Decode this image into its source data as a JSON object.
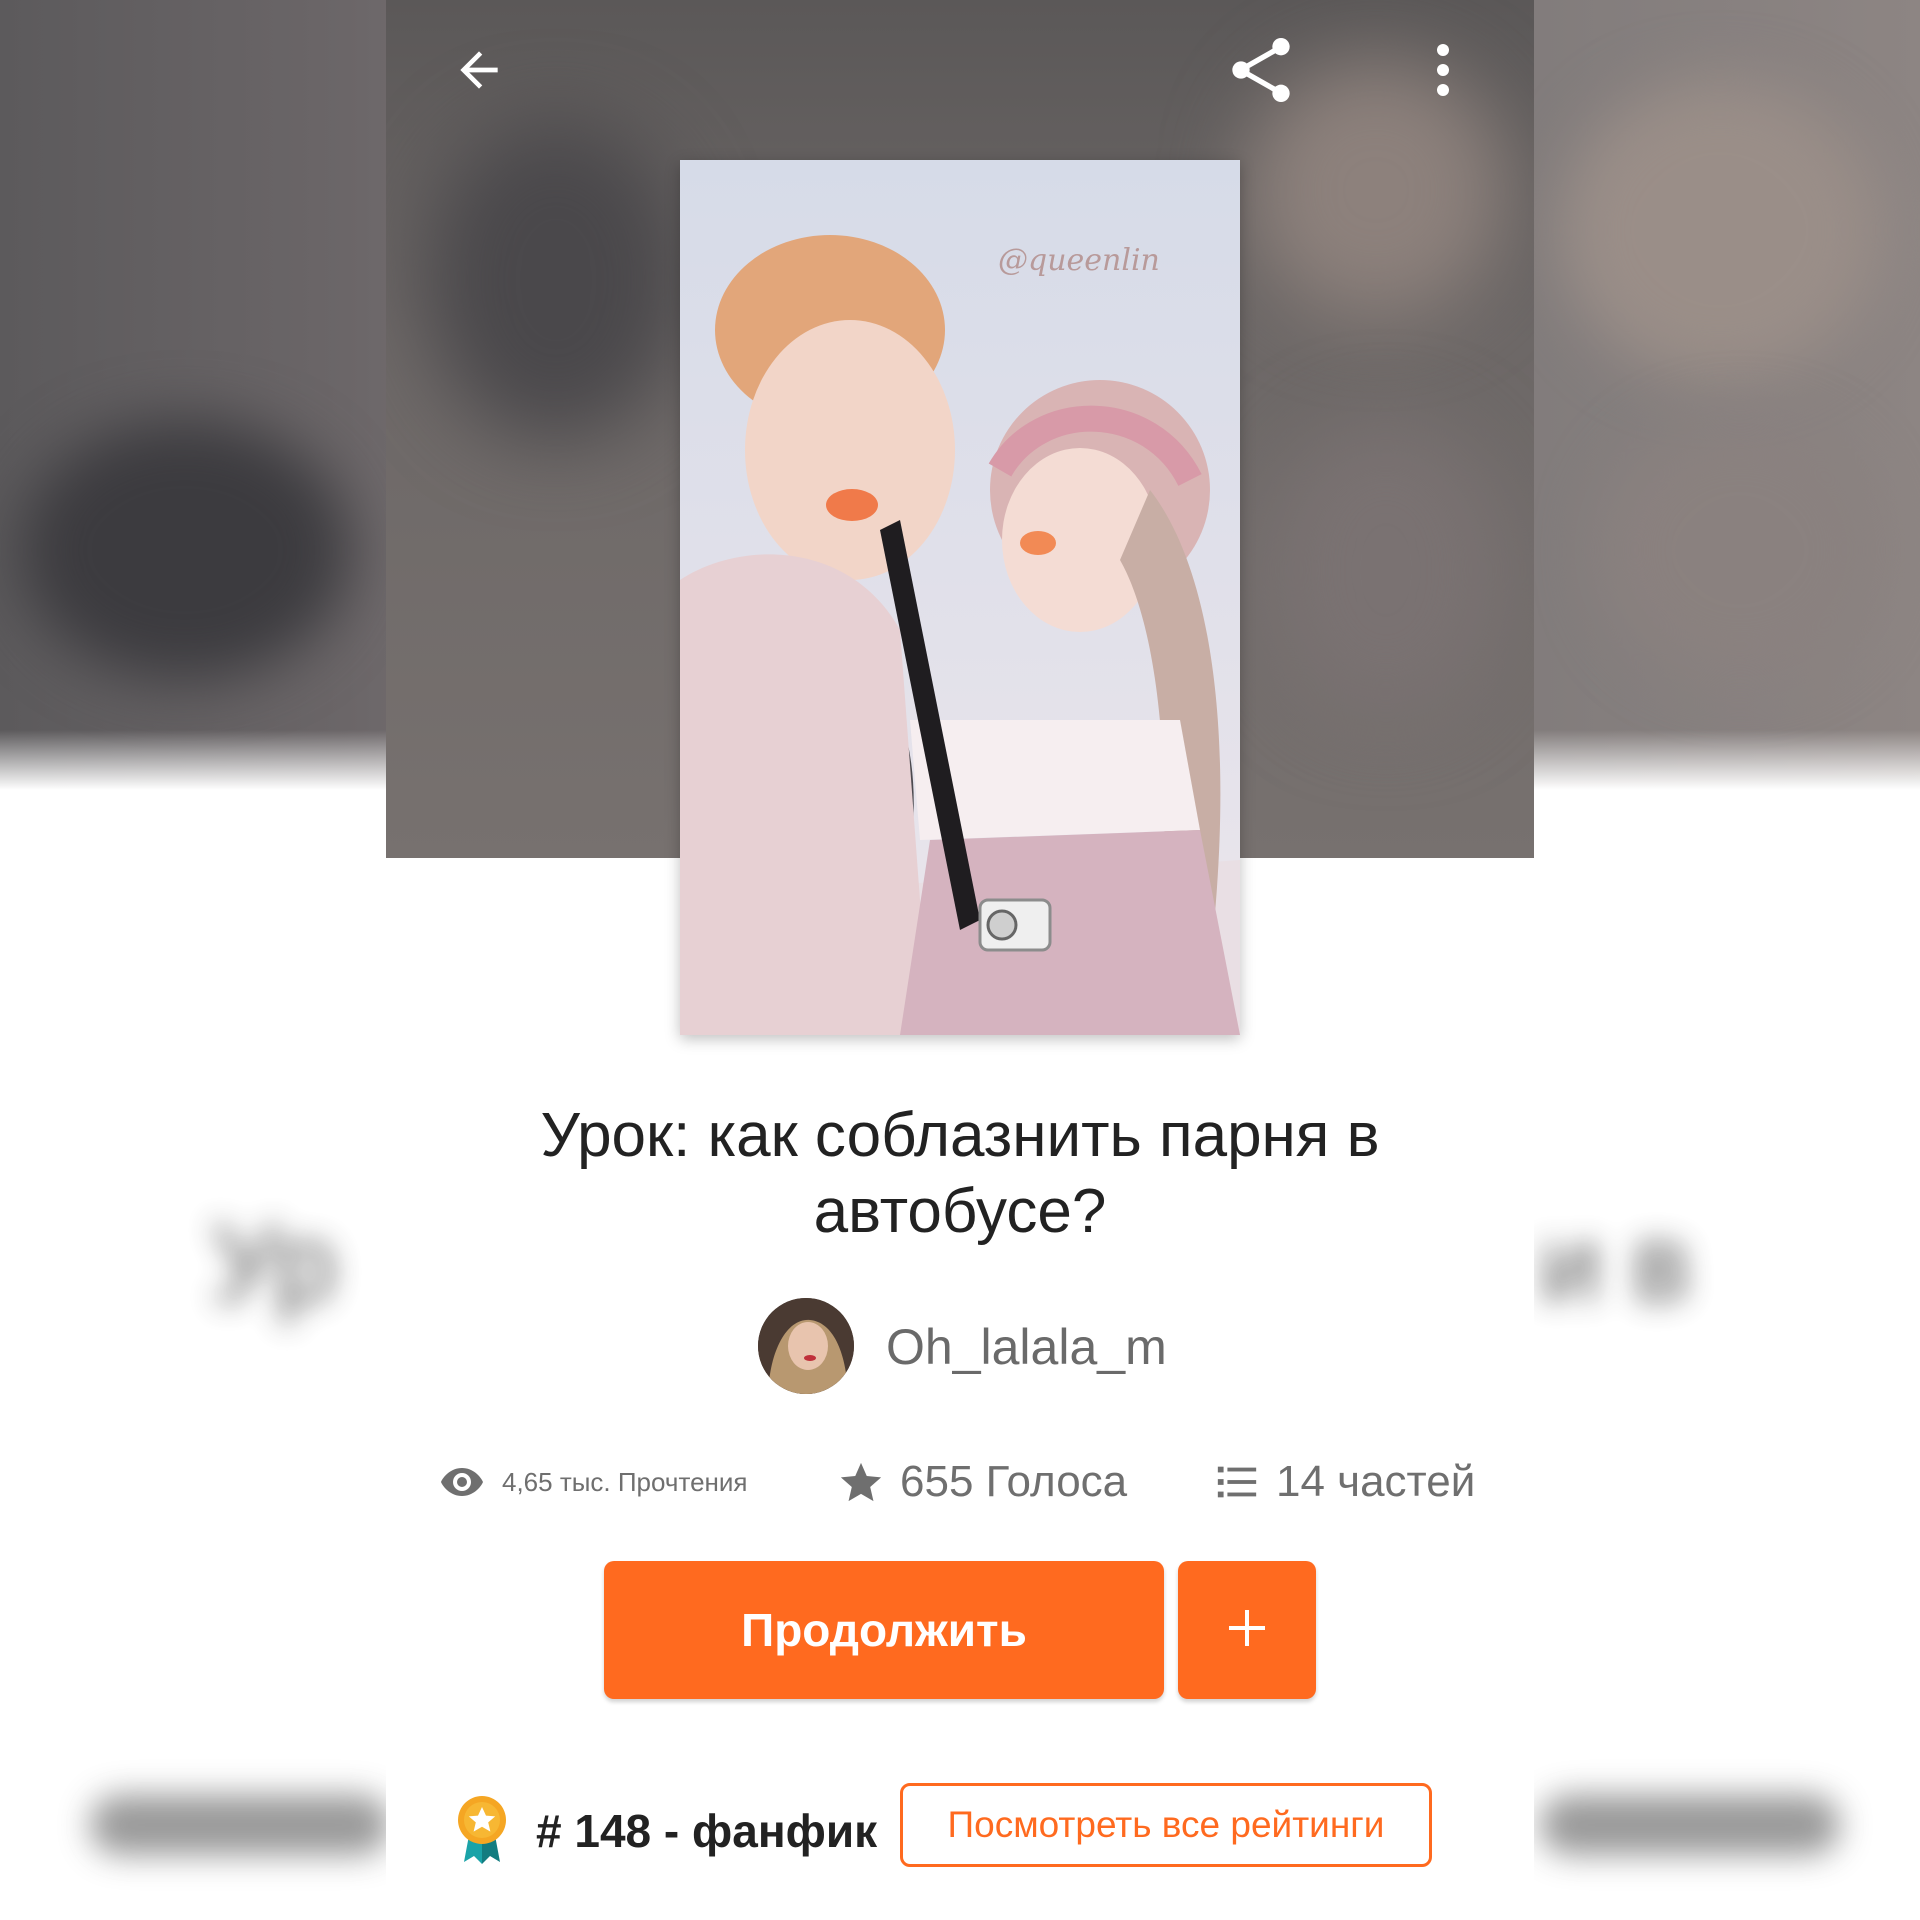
{
  "toolbar": {
    "back_icon": "arrow-left-icon",
    "share_icon": "share-icon",
    "more_icon": "more-vertical-icon"
  },
  "story": {
    "title": "Урок: как соблазнить парня в автобусе?",
    "cover_watermark": "@queenlin",
    "author": "Oh_lalala_m"
  },
  "stats": {
    "reads": "4,65 тыс. Прочтения",
    "votes": "655 Голоса",
    "parts": "14 частей"
  },
  "actions": {
    "continue_label": "Продолжить",
    "add_icon": "plus-icon"
  },
  "ranking": {
    "text": "# 148 - фанфик",
    "button_label": "Посмотреть все рейтинги",
    "badge_icon": "award-medal-icon"
  },
  "colors": {
    "accent": "#ff6a1f",
    "title": "#222222",
    "muted": "#6f6f6f"
  }
}
